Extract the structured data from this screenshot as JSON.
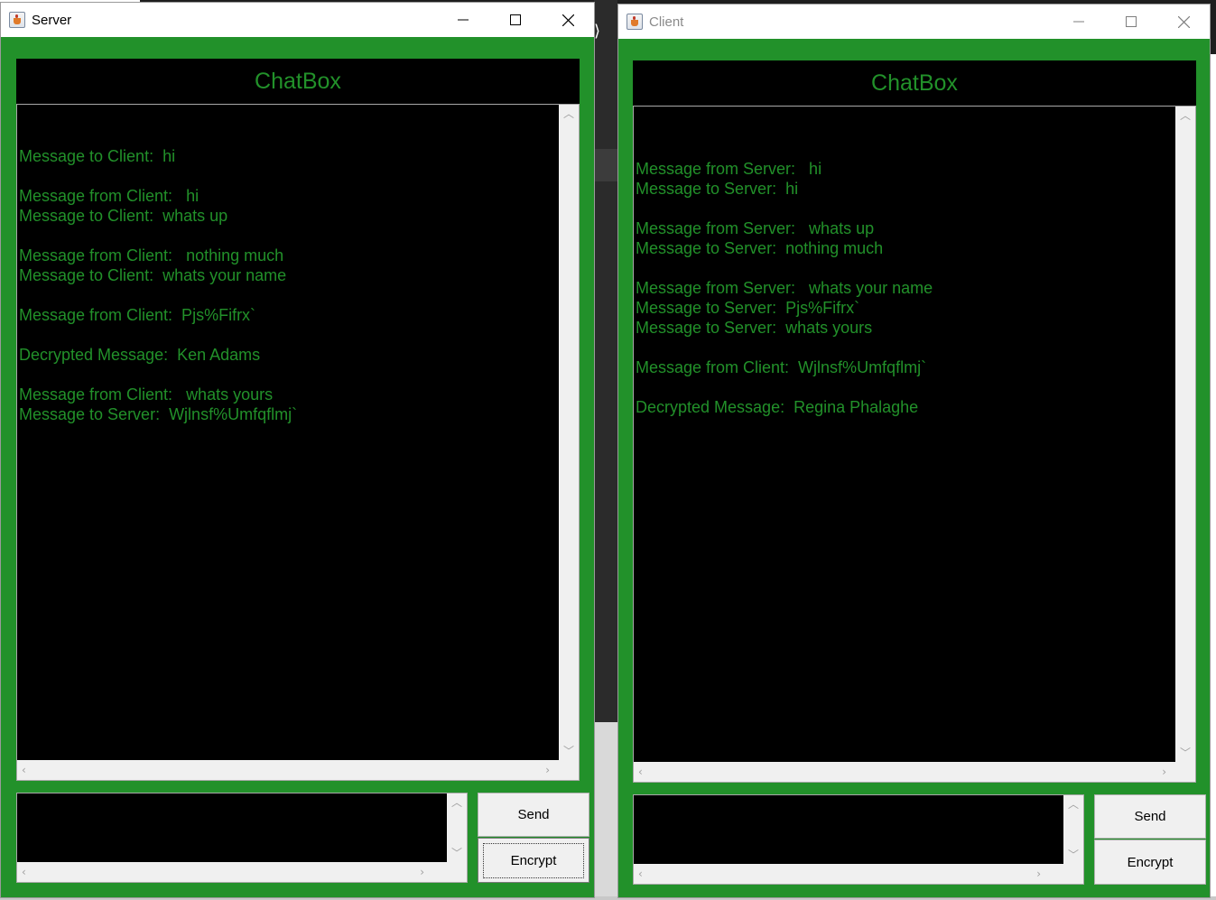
{
  "server": {
    "title": "Server",
    "header": "ChatBox",
    "messages": [
      "",
      "Message to Client:  hi",
      "",
      "Message from Client:   hi",
      "Message to Client:  whats up",
      "",
      "Message from Client:   nothing much",
      "Message to Client:  whats your name",
      "",
      "Message from Client:  Pjs%Fifrx`",
      "",
      "Decrypted Message:  Ken Adams",
      "",
      "Message from Client:   whats yours",
      "Message to Server:  Wjlnsf%Umfqflmj`"
    ],
    "input_value": "",
    "send_label": "Send",
    "encrypt_label": "Encrypt"
  },
  "client": {
    "title": "Client",
    "header": "ChatBox",
    "messages": [
      "",
      "",
      "Message from Server:   hi",
      "Message to Server:  hi",
      "",
      "Message from Server:   whats up",
      "Message to Server:  nothing much",
      "",
      "Message from Server:   whats your name",
      "Message to Server:  Pjs%Fifrx`",
      "Message to Server:  whats yours",
      "",
      "Message from Client:  Wjlnsf%Umfqflmj`",
      "",
      "Decrypted Message:  Regina Phalaghe"
    ],
    "input_value": "",
    "send_label": "Send",
    "encrypt_label": "Encrypt"
  },
  "colors": {
    "window_bg": "#22912a",
    "chat_text": "#22912a",
    "chat_bg": "#000000"
  },
  "icons": [
    "java-app-icon",
    "minimize-icon",
    "maximize-icon",
    "close-icon"
  ]
}
